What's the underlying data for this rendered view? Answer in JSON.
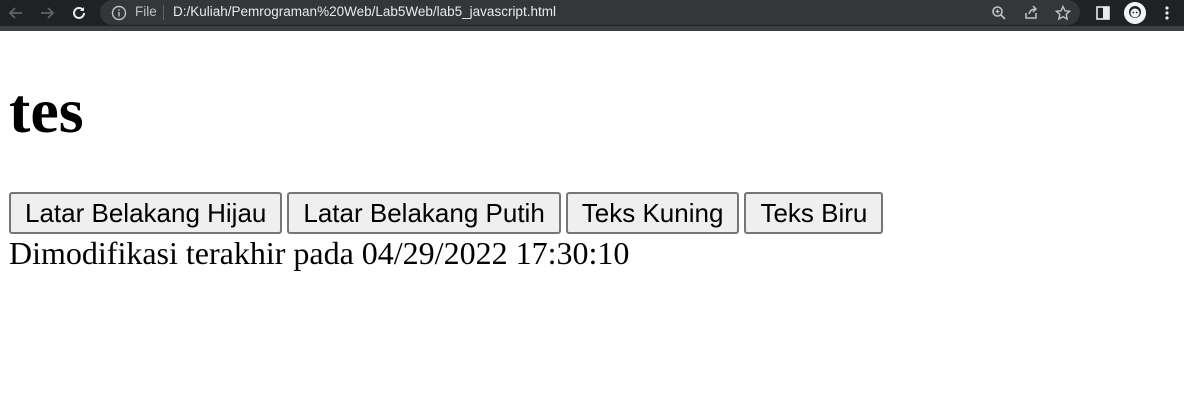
{
  "browser": {
    "omnibox": {
      "scheme_label": "File",
      "url": "D:/Kuliah/Pemrograman%20Web/Lab5Web/lab5_javascript.html"
    }
  },
  "page": {
    "heading": "tes",
    "buttons": [
      {
        "label": "Latar Belakang Hijau"
      },
      {
        "label": "Latar Belakang Putih"
      },
      {
        "label": "Teks Kuning"
      },
      {
        "label": "Teks Biru"
      }
    ],
    "last_modified_text": "Dimodifikasi terakhir pada 04/29/2022 17:30:10"
  },
  "colors": {
    "toolbar_bg": "#202124",
    "omnibox_bg": "#35363a",
    "button_bg": "#efefef",
    "button_border": "#767676"
  }
}
